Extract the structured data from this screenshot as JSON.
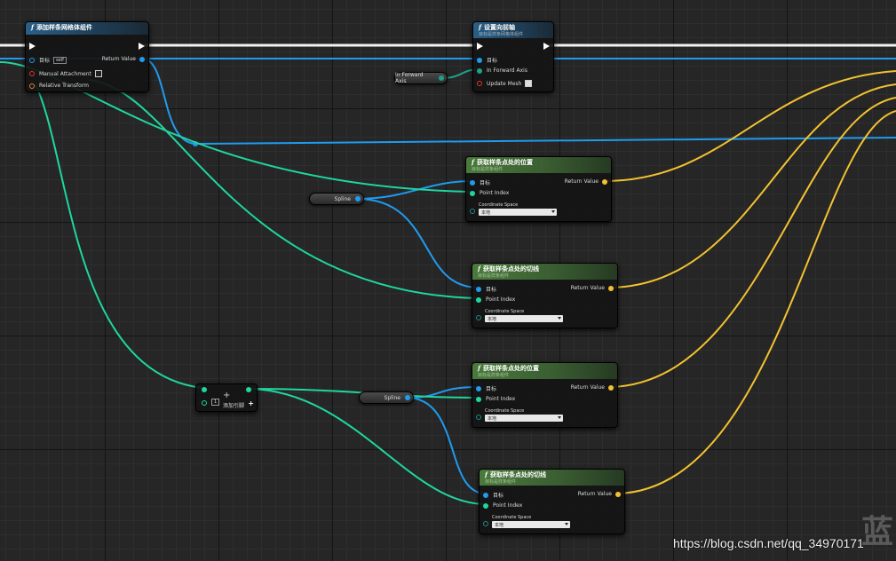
{
  "nodes": {
    "add_spline_mesh": {
      "title": "添加样条网格体组件",
      "pins": {
        "target": "目标",
        "self": "self",
        "manual_attachment": "Manual Attachment",
        "relative_transform": "Relative Transform",
        "return_value": "Return Value"
      },
      "manual_attachment_checked": false
    },
    "set_forward_axis": {
      "title": "设置向前轴",
      "subtitle": "目标是样条网格体组件",
      "pins": {
        "target": "目标",
        "in_forward_axis": "In Forward Axis",
        "update_mesh": "Update Mesh"
      },
      "update_mesh_checked": true
    },
    "get_location_1": {
      "title": "获取样条点处的位置",
      "subtitle": "目标是样条组件",
      "pins": {
        "target": "目标",
        "point_index": "Point Index",
        "coordinate_space": "Coordinate Space",
        "return_value": "Return Value"
      },
      "coordinate_space_value": "本地"
    },
    "get_tangent_1": {
      "title": "获取样条点处的切线",
      "subtitle": "目标是样条组件",
      "pins": {
        "target": "目标",
        "point_index": "Point Index",
        "coordinate_space": "Coordinate Space",
        "return_value": "Return Value"
      },
      "coordinate_space_value": "本地"
    },
    "get_location_2": {
      "title": "获取样条点处的位置",
      "subtitle": "目标是样条组件",
      "pins": {
        "target": "目标",
        "point_index": "Point Index",
        "coordinate_space": "Coordinate Space",
        "return_value": "Return Value"
      },
      "coordinate_space_value": "本地"
    },
    "get_tangent_2": {
      "title": "获取样条点处的切线",
      "subtitle": "目标是样条组件",
      "pins": {
        "target": "目标",
        "point_index": "Point Index",
        "coordinate_space": "Coordinate Space",
        "return_value": "Return Value"
      },
      "coordinate_space_value": "本地"
    }
  },
  "variables": {
    "in_forward_axis": "In Forward Axis",
    "spline_1": "Spline",
    "spline_2": "Spline"
  },
  "add_node": {
    "value": "1",
    "add_pin_label": "添加引脚"
  },
  "watermark": "https://blog.csdn.net/qq_34970171",
  "corner_glyph": "蓝",
  "colors": {
    "object_pin": "#1f9bf0",
    "int_pin": "#1ed7a0",
    "vector_pin": "#f2c230",
    "header_blue": "#2b5f86",
    "header_green": "#4a7a3c"
  }
}
